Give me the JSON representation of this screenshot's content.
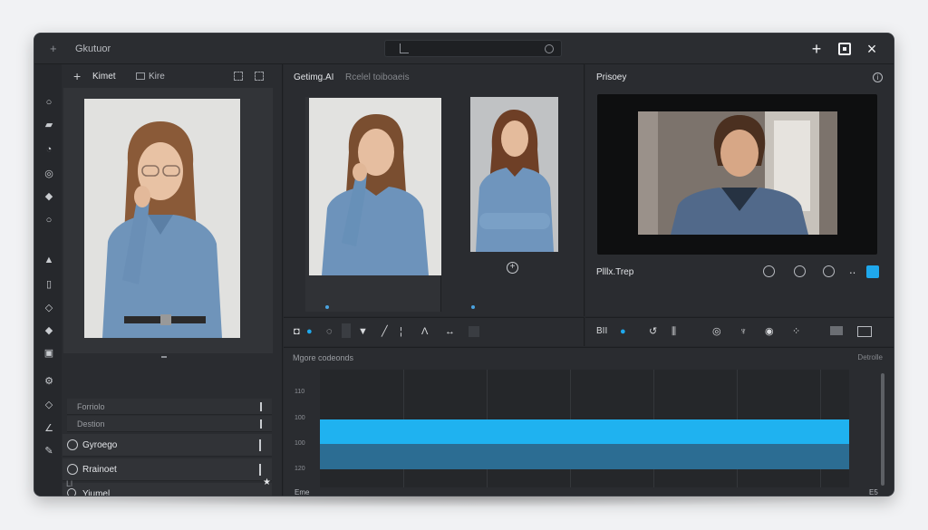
{
  "window": {
    "title": "Gkutuor",
    "controls": [
      "+",
      "×"
    ]
  },
  "left_panel": {
    "tab_primary": "Kimet",
    "tab_secondary": "Kire",
    "rows": [
      {
        "label": "Forriolo"
      },
      {
        "label": "Destion"
      }
    ],
    "items": [
      {
        "label": "Gyroego",
        "icon": "circle-icon"
      },
      {
        "label": "Rrainoet",
        "icon": "circle-icon"
      },
      {
        "label": "Yiumel",
        "icon": "search-icon"
      }
    ],
    "footer_left": "Ll",
    "footer_star": "★"
  },
  "center_panel": {
    "title": "Getimg.AI",
    "subtitle": "Rcelel toiboaeis",
    "add_symbol": "+"
  },
  "right_panel": {
    "title": "Prisoey",
    "info": "i",
    "preview_label": "Plllx.Trep",
    "accent": "#1fa8ec"
  },
  "toolbar_right": {
    "label": "BII"
  },
  "timeline": {
    "title": "Mgore codeonds",
    "right_label": "Detrolle",
    "y_ticks": [
      "110",
      "100",
      "100",
      "120"
    ],
    "x_left": "Eme",
    "x_right": "E5",
    "bar_colors": [
      "#1fb2f0",
      "#2c6d93"
    ]
  }
}
